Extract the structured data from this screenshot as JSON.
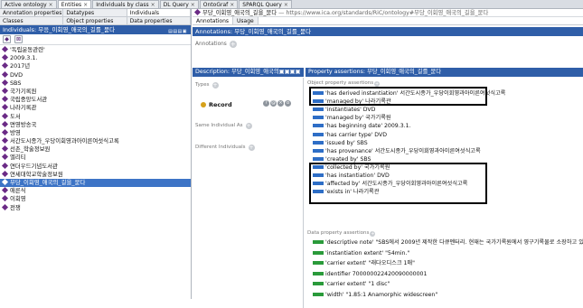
{
  "tabs": [
    {
      "label": "Active ontology",
      "close": "×"
    },
    {
      "label": "Entities",
      "close": "×"
    },
    {
      "label": "Individuals by class",
      "close": "×"
    },
    {
      "label": "DL Query",
      "close": "×"
    },
    {
      "label": "OntoGraf",
      "close": "×"
    },
    {
      "label": "SPARQL Query",
      "close": "×"
    }
  ],
  "left": {
    "subtabs_row1": [
      "Annotation properties",
      "Datatypes",
      "Individuals"
    ],
    "subtabs_row2": [
      "Classes",
      "Object properties",
      "Data properties"
    ],
    "header": "Individuals: 무응_이회영_애국의_길를_묻다",
    "header_controls": "▤▤▤▣",
    "add_icon_glyph": "◆",
    "delete_icon_glyph": "⊠",
    "items": [
      "'독립운동관련'",
      "2009.3.1.",
      "2017년",
      "DVD",
      "SBS",
      "국가기록원",
      "국립중앙도서관",
      "나라기록관",
      "도서",
      "면영방송국",
      "방영",
      "서간도시종가_우당이회영과아이른여섯식고록",
      "선촌_학술정보원",
      "엘리티",
      "연더우드기념도서관",
      "연세대학교학술정보원",
      "무당_이회영_애국의_길을_묻다",
      "애른식",
      "이회영",
      "전쟁"
    ],
    "selected_index": 16
  },
  "right": {
    "iri_title": "무당_이회영_애국의_길을_묻다",
    "iri_url": "— https://www.ica.org/standards/RiC/ontology#무당_이회영_애국의_길을_묻다",
    "tabs": [
      "Annotations",
      "Usage"
    ],
    "annotations_header": "Annotations: 무당_이회영_애국의_길를_묻다",
    "annotations_label": "Annotations",
    "description_header": "Description: 무당_이회영_애국의▣▣▣▣",
    "property_header": "Property assertions: 무당_이회영_애국의_길를_묻다",
    "types_label": "Types",
    "record_label": "Record",
    "record_buttons": [
      "?",
      "@",
      "×",
      "o"
    ],
    "same_label": "Same Individual As",
    "different_label": "Different Individuals",
    "object_section": "Object property assertions",
    "data_section": "Data property assertions",
    "object_props": [
      "'has derived instantiation'  서간도시종가_우당이회영과아이른여섯식고록",
      "'managed by'  나라기록관",
      "'instantiates'  DVD",
      "'managed by'  국가기록원",
      "'has beginning date'  2009.3.1.",
      "'has carrier type'  DVD",
      "'issued by'  SBS",
      "'has provenance'  서간도시종가_우당이회영과아이른여섯식고록",
      "'created by'  SBS",
      "'collected by'  국가기록원",
      "'has instantiation'  DVD",
      "'affected by'  서간도시종가_우당이회영과아이른여섯식고록",
      "'exists in'  나라기록관"
    ],
    "data_props": [
      "'descriptive note'  \"SBS에서 2009년 제작한 다큐멘터리. 현재는 국가기록원에서 영구기록물로 소장하고 있음",
      "'instantiation extent'  \"54min.\"",
      "'carrier extent'  \"래다오디스크 1매\"",
      "identifier  700000022420090000001",
      "'carrier extent'  \"1 disc\"",
      "'width'  \"1.85:1 Anamorphic widescreen\""
    ]
  }
}
